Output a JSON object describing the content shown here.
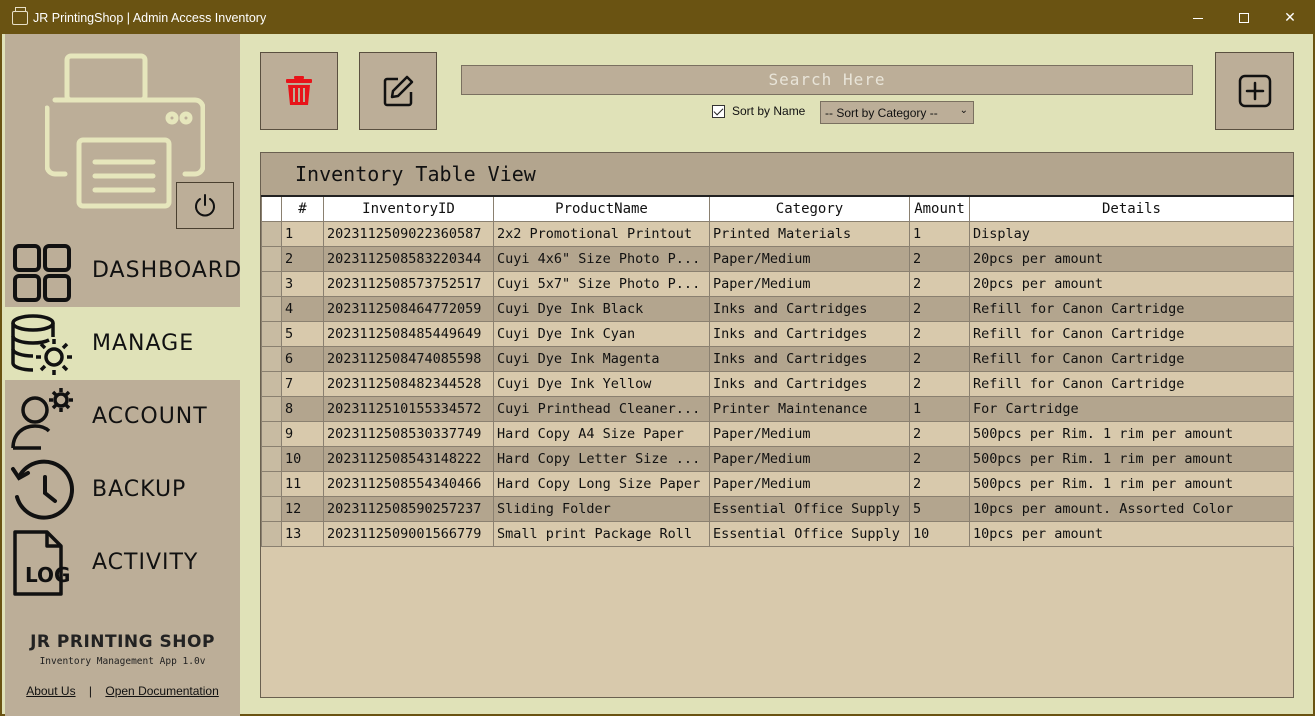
{
  "window": {
    "title": "JR PrintingShop | Admin Access Inventory"
  },
  "sidebar": {
    "items": [
      {
        "label": "DASHBOARD",
        "icon": "dashboard-grid-icon"
      },
      {
        "label": "MANAGE",
        "icon": "database-gear-icon"
      },
      {
        "label": "ACCOUNT",
        "icon": "user-gear-icon"
      },
      {
        "label": "BACKUP",
        "icon": "history-clock-icon"
      },
      {
        "label": "ACTIVITY",
        "icon": "log-file-icon"
      }
    ],
    "brand_title": "JR PRINTING SHOP",
    "brand_subtitle": "Inventory Management App 1.0v",
    "about_link": "About Us",
    "separator": "|",
    "docs_link": "Open Documentation"
  },
  "toolbar": {
    "search_placeholder": "Search Here",
    "sort_by_name_label": "Sort by Name",
    "sort_by_name_checked": true,
    "sort_category_value": "-- Sort by Category --"
  },
  "table": {
    "title": "Inventory Table View",
    "columns": [
      "#",
      "InventoryID",
      "ProductName",
      "Category",
      "Amount",
      "Details"
    ],
    "rows": [
      [
        "1",
        "2023112509022360587",
        "2x2 Promotional Printout",
        "Printed Materials",
        "1",
        "Display"
      ],
      [
        "2",
        "2023112508583220344",
        "Cuyi 4x6\" Size Photo P...",
        "Paper/Medium",
        "2",
        "20pcs per amount"
      ],
      [
        "3",
        "2023112508573752517",
        "Cuyi 5x7\" Size Photo P...",
        "Paper/Medium",
        "2",
        "20pcs per amount"
      ],
      [
        "4",
        "2023112508464772059",
        "Cuyi Dye Ink Black",
        "Inks and Cartridges",
        "2",
        "Refill for Canon Cartridge"
      ],
      [
        "5",
        "2023112508485449649",
        "Cuyi Dye Ink Cyan",
        "Inks and Cartridges",
        "2",
        "Refill for Canon Cartridge"
      ],
      [
        "6",
        "2023112508474085598",
        "Cuyi Dye Ink Magenta",
        "Inks and Cartridges",
        "2",
        "Refill for Canon Cartridge"
      ],
      [
        "7",
        "2023112508482344528",
        "Cuyi Dye Ink Yellow",
        "Inks and Cartridges",
        "2",
        "Refill for Canon Cartridge"
      ],
      [
        "8",
        "2023112510155334572",
        "Cuyi Printhead Cleaner...",
        "Printer Maintenance",
        "1",
        "For Cartridge"
      ],
      [
        "9",
        "2023112508530337749",
        "Hard Copy A4 Size Paper",
        "Paper/Medium",
        "2",
        "500pcs per Rim. 1 rim per amount"
      ],
      [
        "10",
        "2023112508543148222",
        "Hard Copy Letter Size ...",
        "Paper/Medium",
        "2",
        "500pcs per Rim. 1 rim per amount"
      ],
      [
        "11",
        "2023112508554340466",
        "Hard Copy Long Size Paper",
        "Paper/Medium",
        "2",
        "500pcs per Rim. 1 rim per amount"
      ],
      [
        "12",
        "2023112508590257237",
        "Sliding Folder",
        "Essential Office Supply",
        "5",
        "10pcs per amount. Assorted Color"
      ],
      [
        "13",
        "2023112509001566779",
        "Small print Package Roll",
        "Essential Office Supply",
        "10",
        "10pcs per amount"
      ]
    ]
  },
  "colors": {
    "titlebar": "#6a5312",
    "sidebar": "#bcae98",
    "accent_bg": "#e0e2b8",
    "delete_red": "#e8141a"
  }
}
